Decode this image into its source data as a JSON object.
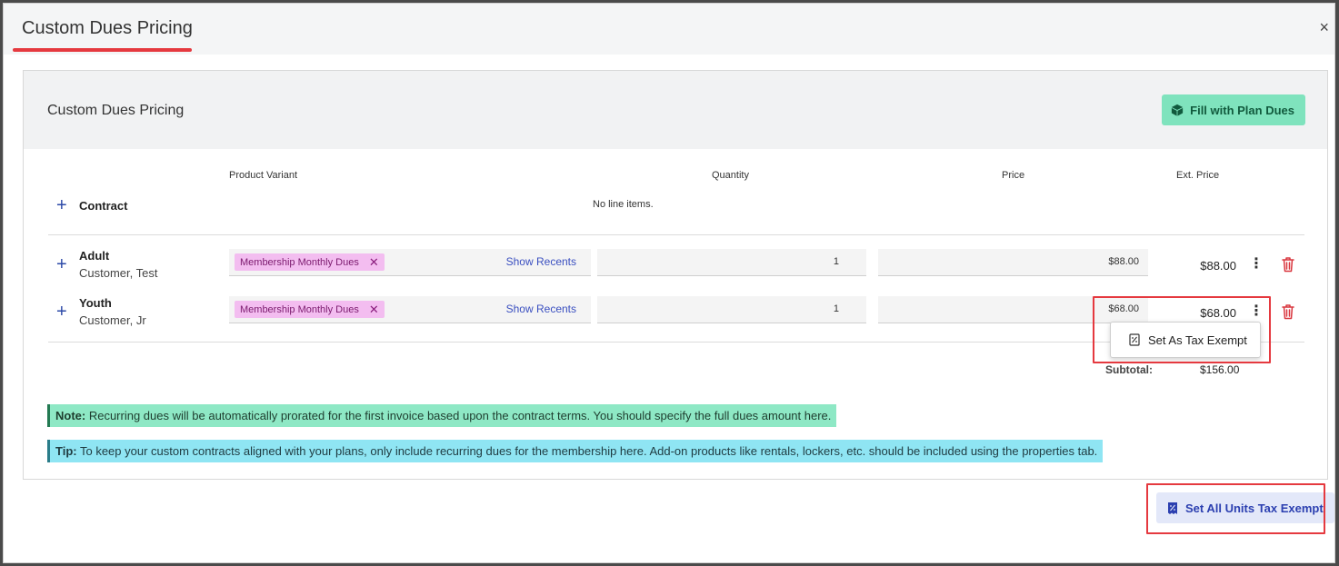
{
  "modal": {
    "title": "Custom Dues Pricing",
    "close_symbol": "×"
  },
  "panel": {
    "title": "Custom Dues Pricing",
    "fill_button_label": "Fill with Plan Dues",
    "fill_button_icon": "box-icon"
  },
  "table": {
    "headers": {
      "product_variant": "Product Variant",
      "quantity": "Quantity",
      "price": "Price",
      "ext_price": "Ext. Price"
    },
    "contract_group": {
      "name": "Contract",
      "empty_text": "No line items."
    },
    "rows": [
      {
        "name": "Adult",
        "sub": "Customer, Test",
        "variant_chip": "Membership Monthly Dues",
        "show_recents": "Show Recents",
        "quantity": "1",
        "price": "$88.00",
        "ext_price": "$88.00"
      },
      {
        "name": "Youth",
        "sub": "Customer, Jr",
        "variant_chip": "Membership Monthly Dues",
        "show_recents": "Show Recents",
        "quantity": "1",
        "price": "$68.00",
        "ext_price": "$68.00"
      }
    ],
    "subtotal_label": "Subtotal:",
    "subtotal_value": "$156.00"
  },
  "context_menu": {
    "item_label": "Set As Tax Exempt",
    "item_icon": "tax-document-icon"
  },
  "note": {
    "label": "Note:",
    "text": " Recurring dues will be automatically prorated for the first invoice based upon the contract terms. You should specify the full dues amount here."
  },
  "tip": {
    "label": "Tip:",
    "text": " To keep your custom contracts aligned with your plans, only include recurring dues for the membership here. Add-on products like rentals, lockers, etc. should be included using the properties tab."
  },
  "footer": {
    "tax_all_button_label": "Set All Units Tax Exempt",
    "tax_all_button_icon": "tax-receipt-icon"
  },
  "colors": {
    "highlight": "#e5393f",
    "fill_button_bg": "#7fe3bd",
    "chip_bg": "#f3bdf0",
    "link_blue": "#3a4fc0",
    "trash_red": "#d9363e",
    "note_bg": "#8ee8c5",
    "tip_bg": "#8fe5f3"
  }
}
